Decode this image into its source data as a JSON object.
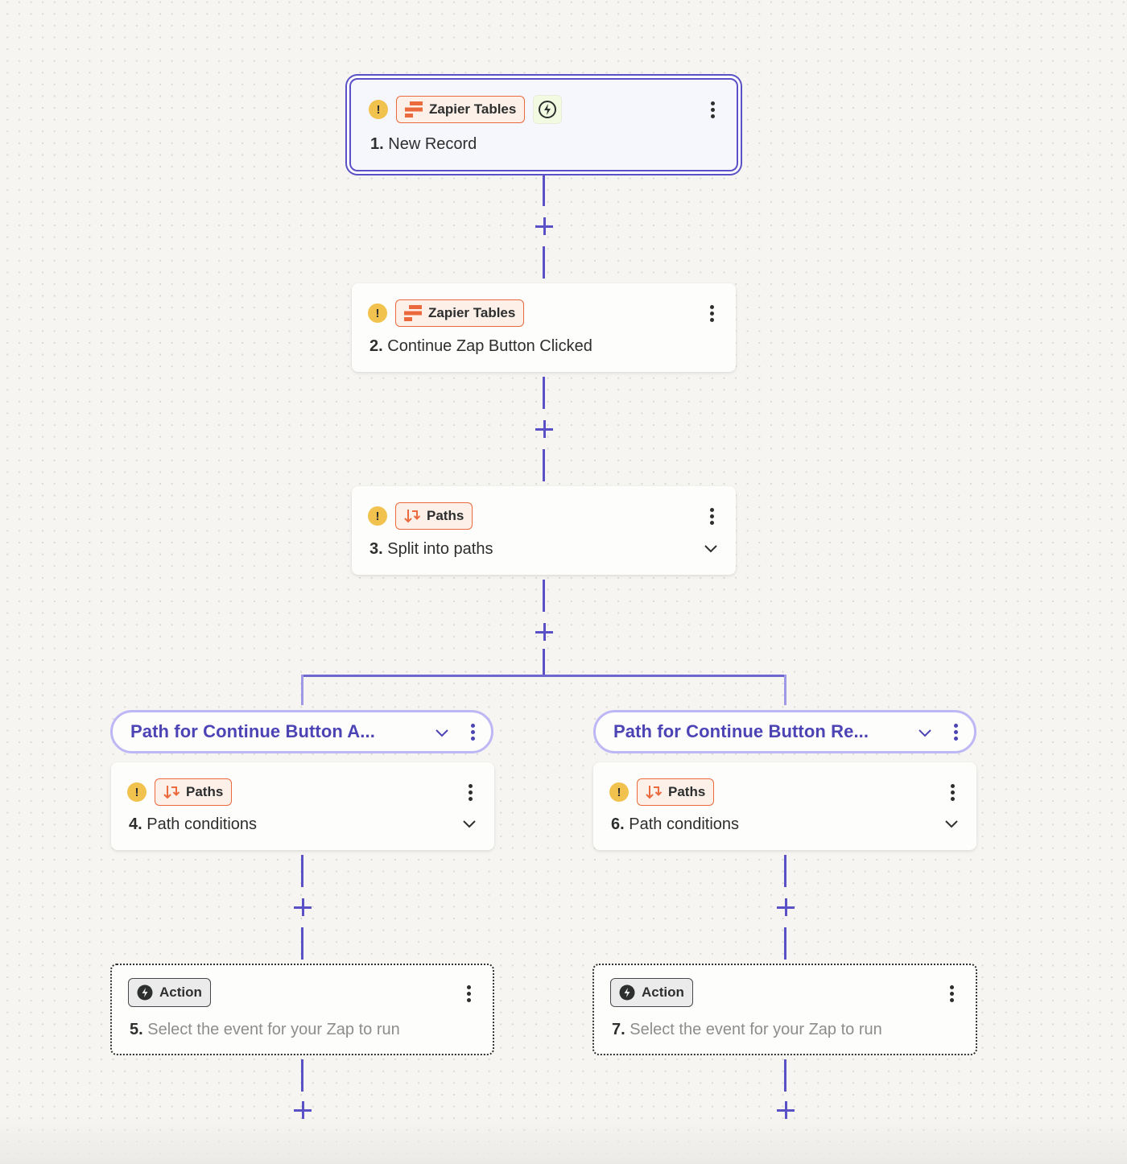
{
  "colors": {
    "accent": "#5a51c6",
    "path_label": "#4c43b5",
    "app_orange": "#ea6a3d",
    "warning": "#f2c24f",
    "trigger_green_bg": "#f2fbe2"
  },
  "steps": [
    {
      "number": "1.",
      "title": "New Record",
      "app": "Zapier Tables",
      "app_icon": "zapier-tables-icon",
      "warning": "!",
      "trigger_icon": "lightning-bolt-icon",
      "selected": true
    },
    {
      "number": "2.",
      "title": "Continue Zap Button Clicked",
      "app": "Zapier Tables",
      "app_icon": "zapier-tables-icon",
      "warning": "!"
    },
    {
      "number": "3.",
      "title": "Split into paths",
      "app": "Paths",
      "app_icon": "paths-icon",
      "warning": "!",
      "expandable": true
    },
    {
      "number": "4.",
      "title": "Path conditions",
      "app": "Paths",
      "app_icon": "paths-icon",
      "warning": "!",
      "expandable": true
    },
    {
      "number": "5.",
      "title": "Select the event for your Zap to run",
      "app": "Action",
      "app_icon": "action-bolt-icon",
      "placeholder": true
    },
    {
      "number": "6.",
      "title": "Path conditions",
      "app": "Paths",
      "app_icon": "paths-icon",
      "warning": "!",
      "expandable": true
    },
    {
      "number": "7.",
      "title": "Select the event for your Zap to run",
      "app": "Action",
      "app_icon": "action-bolt-icon",
      "placeholder": true
    }
  ],
  "paths": [
    {
      "label": "Path for Continue Button A..."
    },
    {
      "label": "Path for Continue Button Re..."
    }
  ],
  "add_step_icon": "plus-icon"
}
